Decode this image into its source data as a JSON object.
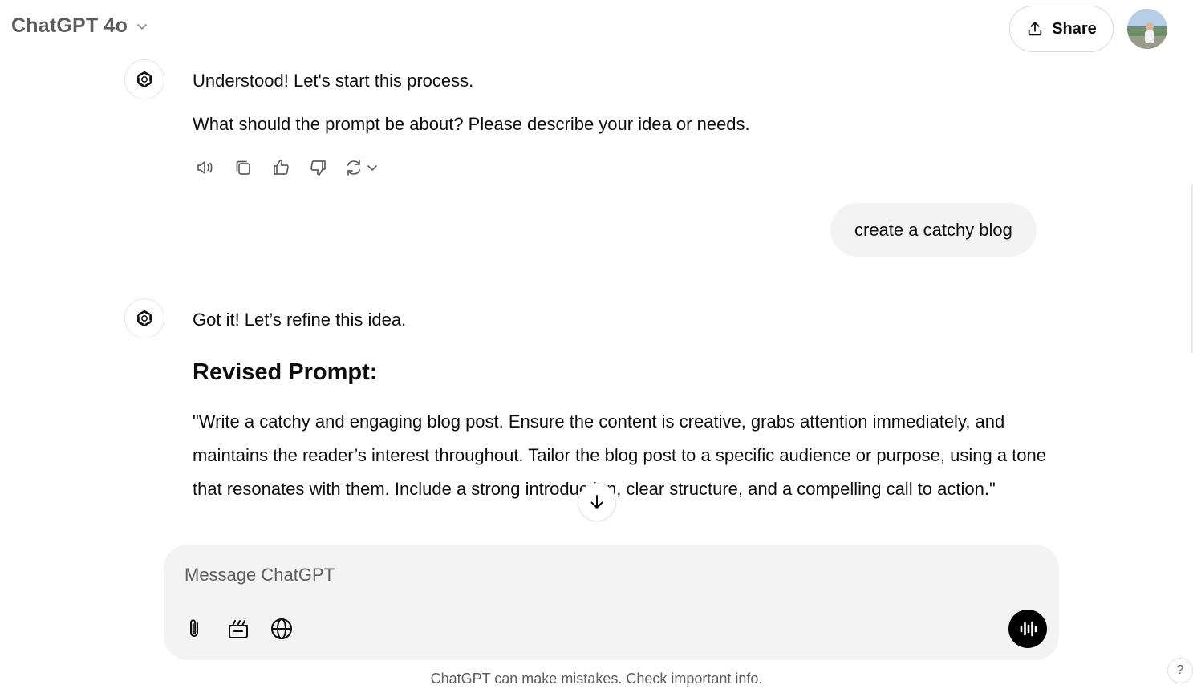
{
  "header": {
    "model_title": "ChatGPT 4o",
    "share_label": "Share"
  },
  "conversation": {
    "assistant_1": {
      "line_1": "Understood! Let's start this process.",
      "line_2": "What should the prompt be about? Please describe your idea or needs."
    },
    "user_1": {
      "text": "create a catchy blog"
    },
    "assistant_2": {
      "intro": "Got it! Let’s refine this idea.",
      "heading": "Revised Prompt:",
      "paragraph": "\"Write a catchy and engaging blog post. Ensure the content is creative, grabs attention immediately, and maintains the reader’s interest throughout. Tailor the blog post to a specific audience or purpose, using a tone that resonates with them. Include a strong introduction, clear structure, and a compelling call to action.\""
    }
  },
  "actions": {
    "icons": [
      "speaker-icon",
      "copy-icon",
      "thumbs-up-icon",
      "thumbs-down-icon",
      "regenerate-icon"
    ]
  },
  "composer": {
    "placeholder": "Message ChatGPT",
    "tools": [
      "paperclip-icon",
      "canvas-icon",
      "globe-icon"
    ]
  },
  "footer": {
    "disclaimer": "ChatGPT can make mistakes. Check important info.",
    "help_label": "?"
  }
}
